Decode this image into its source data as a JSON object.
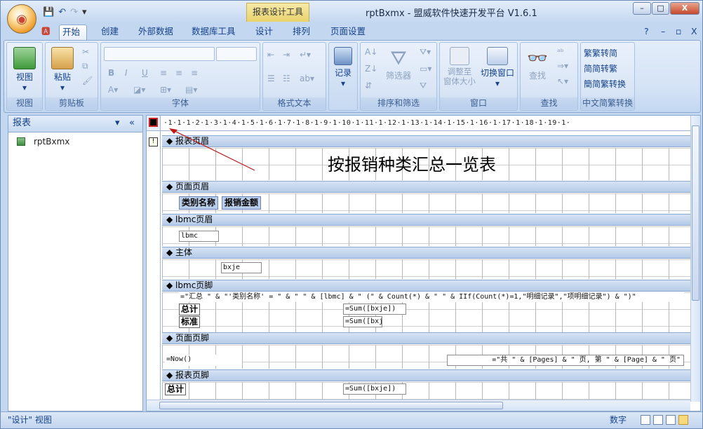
{
  "window": {
    "title": "rptBxmx - 盟威软件快速开发平台 V1.6.1",
    "context_tab": "报表设计工具",
    "office_button": "Office"
  },
  "qat": {
    "save": "save-icon",
    "undo": "undo-icon",
    "redo": "redo-icon",
    "customize": "▾"
  },
  "window_controls": {
    "minimize": "–",
    "maximize": "□",
    "close": "X"
  },
  "tabs": [
    "开始",
    "创建",
    "外部数据",
    "数据库工具",
    "设计",
    "排列",
    "页面设置"
  ],
  "mdi_controls": {
    "help": "?",
    "min": "–",
    "restore": "▫",
    "close": "X"
  },
  "ribbon": {
    "view": {
      "label": "视图",
      "group": "视图"
    },
    "clipboard": {
      "paste": "粘贴",
      "group": "剪贴板"
    },
    "font": {
      "group": "字体",
      "bold": "B",
      "italic": "I",
      "underline": "U"
    },
    "richtext": {
      "group": "格式文本"
    },
    "records": {
      "label": "记录"
    },
    "sort": {
      "group": "排序和筛选",
      "filter": "筛选器"
    },
    "window": {
      "group": "窗口",
      "fit": "调整至\n窗体大小",
      "switch": "切换窗口"
    },
    "find": {
      "group": "查找",
      "find": "查找"
    },
    "convert": {
      "group": "中文简繁转换",
      "t2s": "繁转简",
      "s2t": "简转繁",
      "conv": "简繁转换"
    }
  },
  "nav": {
    "title": "报表",
    "dropdown": "▾",
    "collapse": "«",
    "items": [
      {
        "label": "rptBxmx"
      }
    ]
  },
  "ruler": "·1·1·1·2·1·3·1·4·1·5·1·6·1·7·1·8·1·9·1·10·1·11·1·12·1·13·1·14·1·15·1·16·1·17·1·18·1·19·1·",
  "bands": {
    "report_header": "报表页眉",
    "page_header": "页面页眉",
    "group_header": "lbmc页眉",
    "detail": "主体",
    "group_footer": "lbmc页脚",
    "page_footer": "页面页脚",
    "report_footer": "报表页脚"
  },
  "controls": {
    "title": "按报销种类汇总一览表",
    "col1": "类别名称",
    "col2": "报销金额",
    "lbmc": "lbmc",
    "bxje": "bxje",
    "summary_expr": "=\"汇总 \" & \"'类别名称' = \" & \" \" & [lbmc] & \" (\" & Count(*) & \" \" & IIf(Count(*)=1,\"明细记录\",\"项明细记录\") & \")\"",
    "total": "总计",
    "sum1": "=Sum([bxje])",
    "std": "标准",
    "sum2": "=Sum([bxj",
    "now": "=Now()",
    "pages": "=\"共 \" & [Pages] & \" 页, 第 \" & [Page] & \" 页\"",
    "total2": "总计",
    "sum3": "=Sum([bxje])"
  },
  "status": {
    "view": "\"设计\" 视图",
    "mode": "数字"
  }
}
